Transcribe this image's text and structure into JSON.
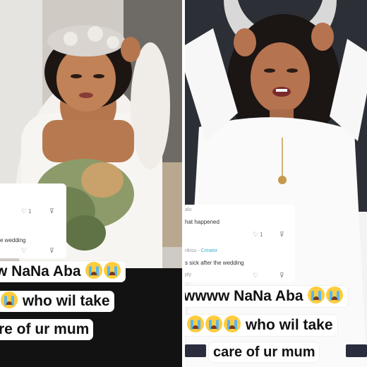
{
  "left": {
    "comment": {
      "like_count": "1",
      "text_fragment": "e wedding"
    },
    "caption": {
      "line1": "w NaNa Aba",
      "line2": "who wil take",
      "line3": "re of ur mum"
    }
  },
  "right": {
    "comment": {
      "user_fragment": "alo",
      "text1": "hat happened",
      "like1": "1",
      "creator_name": "rikisu",
      "creator_label": "Creator",
      "text2": "s sick after the wedding",
      "reply": "ply"
    },
    "caption": {
      "line1": "wwww NaNa Aba",
      "line2": "who wil take",
      "line3": "care of ur mum"
    }
  },
  "colors": {
    "emoji_face": "#ffcc3d",
    "emoji_tear": "#5ab6f0",
    "creator_tag": "#3ab0d6",
    "wall_dark": "#2c2f35"
  },
  "icons": [
    "heart-icon",
    "thumbs-down-icon",
    "crying-face-emoji"
  ]
}
